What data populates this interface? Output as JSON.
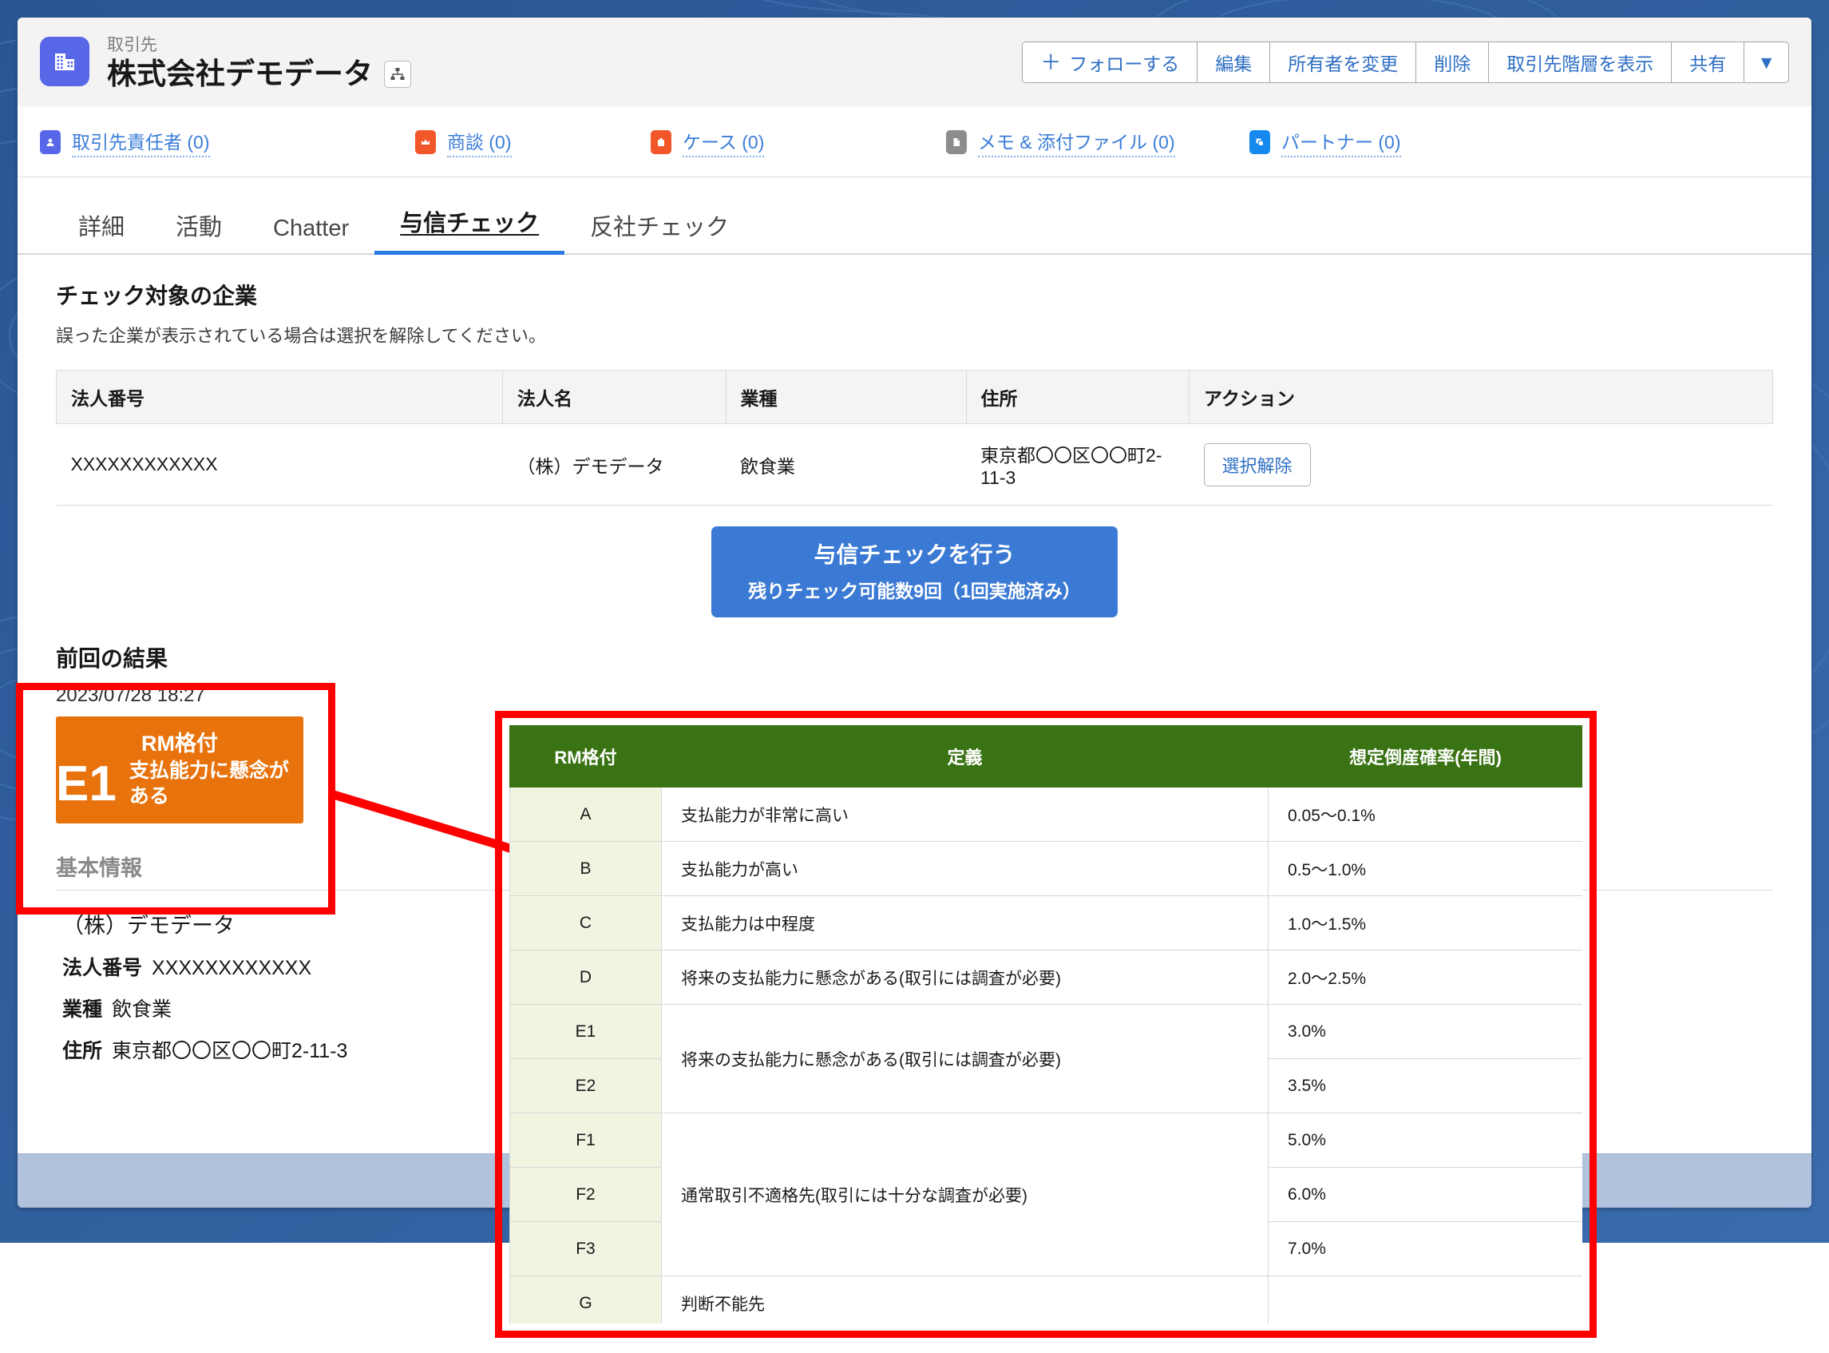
{
  "header": {
    "object_type": "取引先",
    "record_name": "株式会社デモデータ",
    "hierarchy_icon": "hierarchy-icon",
    "object_icon": "account-building-icon",
    "buttons": [
      {
        "label": "フォローする",
        "icon": "plus-icon"
      },
      {
        "label": "編集"
      },
      {
        "label": "所有者を変更"
      },
      {
        "label": "削除"
      },
      {
        "label": "取引先階層を表示"
      },
      {
        "label": "共有"
      },
      {
        "label": "▼",
        "icon": "chevron-down-icon"
      }
    ]
  },
  "quicklinks": [
    {
      "label": "取引先責任者 (0)",
      "icon": "contacts-icon",
      "color": "#5867e8"
    },
    {
      "label": "商談 (0)",
      "icon": "opportunity-icon",
      "color": "#f2572a"
    },
    {
      "label": "ケース (0)",
      "icon": "case-icon",
      "color": "#f2572a"
    },
    {
      "label": "メモ & 添付ファイル (0)",
      "icon": "note-attachment-icon",
      "color": "#8d8d8d"
    },
    {
      "label": "パートナー (0)",
      "icon": "partners-icon",
      "color": "#1589ee"
    }
  ],
  "tabs": [
    {
      "label": "詳細",
      "active": false
    },
    {
      "label": "活動",
      "active": false
    },
    {
      "label": "Chatter",
      "active": false
    },
    {
      "label": "与信チェック",
      "active": true
    },
    {
      "label": "反社チェック",
      "active": false
    }
  ],
  "check_section": {
    "title": "チェック対象の企業",
    "subtitle": "誤った企業が表示されている場合は選択を解除してください。",
    "columns": [
      "法人番号",
      "法人名",
      "業種",
      "住所",
      "アクション"
    ],
    "rows": [
      {
        "corporate_number": "XXXXXXXXXXXX",
        "corporate_name": "（株）デモデータ",
        "industry": "飲食業",
        "address": "東京都〇〇区〇〇町2-11-3",
        "action_label": "選択解除"
      }
    ]
  },
  "cta": {
    "main_label": "与信チェックを行う",
    "sub_label": "残りチェック可能数9回（1回実施済み）",
    "color": "#3b7ad4"
  },
  "previous_result": {
    "title": "前回の結果",
    "timestamp": "2023/07/28 18:27",
    "badge_label": "RM格付",
    "grade": "E1",
    "grade_description": "支払能力に懸念がある",
    "badge_color": "#E8730D"
  },
  "basic_info": {
    "heading": "基本情報",
    "company_name": "（株）デモデータ",
    "fields": [
      {
        "label": "法人番号",
        "value": "XXXXXXXXXXXX"
      },
      {
        "label": "業種",
        "value": "飲食業"
      },
      {
        "label": "住所",
        "value": "東京都〇〇区〇〇町2-11-3"
      }
    ]
  },
  "annotation": {
    "highlight_color": "#fe0000"
  },
  "rating_table": {
    "header_color": "#3a7313",
    "columns": [
      "RM格付",
      "定義",
      "想定倒産確率(年間)"
    ],
    "rows": [
      {
        "grade": "A",
        "definition": "支払能力が非常に高い",
        "definition_rowspan": 1,
        "probability": "0.05〜0.1%"
      },
      {
        "grade": "B",
        "definition": "支払能力が高い",
        "definition_rowspan": 1,
        "probability": "0.5〜1.0%"
      },
      {
        "grade": "C",
        "definition": "支払能力は中程度",
        "definition_rowspan": 1,
        "probability": "1.0〜1.5%"
      },
      {
        "grade": "D",
        "definition": "将来の支払能力に懸念がある(取引には調査が必要)",
        "definition_rowspan": 1,
        "probability": "2.0〜2.5%"
      },
      {
        "grade": "E1",
        "definition": "将来の支払能力に懸念がある(取引には調査が必要)",
        "definition_rowspan": 2,
        "probability": "3.0%"
      },
      {
        "grade": "E2",
        "definition": null,
        "definition_rowspan": 0,
        "probability": "3.5%"
      },
      {
        "grade": "F1",
        "definition": "通常取引不適格先(取引には十分な調査が必要)",
        "definition_rowspan": 3,
        "probability": "5.0%"
      },
      {
        "grade": "F2",
        "definition": null,
        "definition_rowspan": 0,
        "probability": "6.0%"
      },
      {
        "grade": "F3",
        "definition": null,
        "definition_rowspan": 0,
        "probability": "7.0%"
      },
      {
        "grade": "G",
        "definition": "判断不能先",
        "definition_rowspan": 1,
        "probability": ""
      }
    ]
  }
}
